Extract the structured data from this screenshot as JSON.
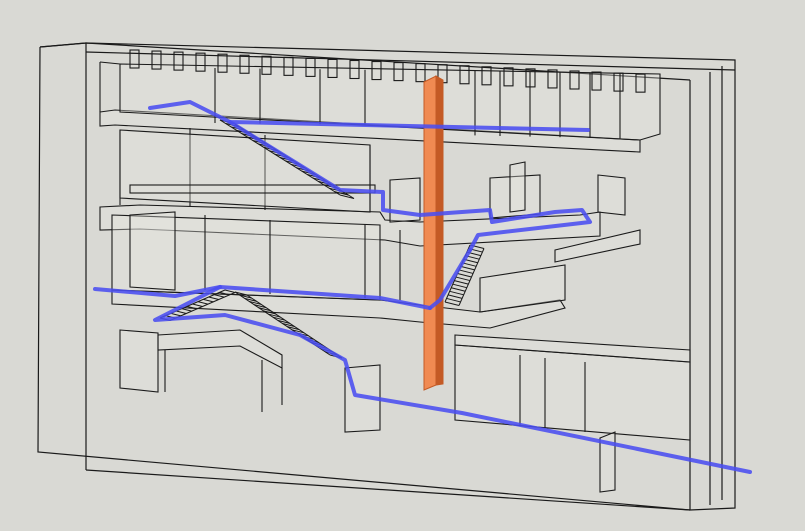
{
  "scene": {
    "background": "#d9d9d4",
    "line_color": "#1a1a1a",
    "glass_tint": "#e4e4e0",
    "path_color": "#4a4df0",
    "column_color": "#f08a52",
    "column_edge": "#c45a25",
    "path_icon": "circulation-path-line",
    "column_icon": "vertical-core-column"
  }
}
